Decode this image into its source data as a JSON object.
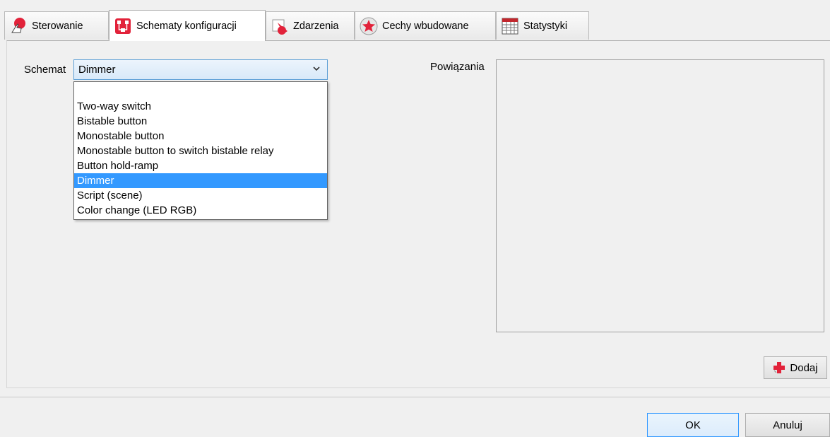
{
  "tabs": [
    {
      "label": "Sterowanie",
      "icon": "hand-pointer-icon"
    },
    {
      "label": "Schematy konfiguracji",
      "icon": "schema-icon"
    },
    {
      "label": "Zdarzenia",
      "icon": "event-icon"
    },
    {
      "label": "Cechy wbudowane",
      "icon": "star-icon"
    },
    {
      "label": "Statystyki",
      "icon": "table-grid-icon"
    }
  ],
  "active_tab": "Schematy konfiguracji",
  "schemat": {
    "label": "Schemat",
    "selected": "Dimmer",
    "options": [
      "Two-way switch",
      "Bistable button",
      "Monostable button",
      "Monostable button to switch bistable relay",
      "Button hold-ramp",
      "Dimmer",
      "Script (scene)",
      "Color change (LED RGB)"
    ]
  },
  "powiazania": {
    "label": "Powiązania"
  },
  "buttons": {
    "add": "Dodaj",
    "ok": "OK",
    "cancel": "Anuluj"
  },
  "colors": {
    "accent": "#3399ff",
    "icon_red": "#e2223a"
  }
}
